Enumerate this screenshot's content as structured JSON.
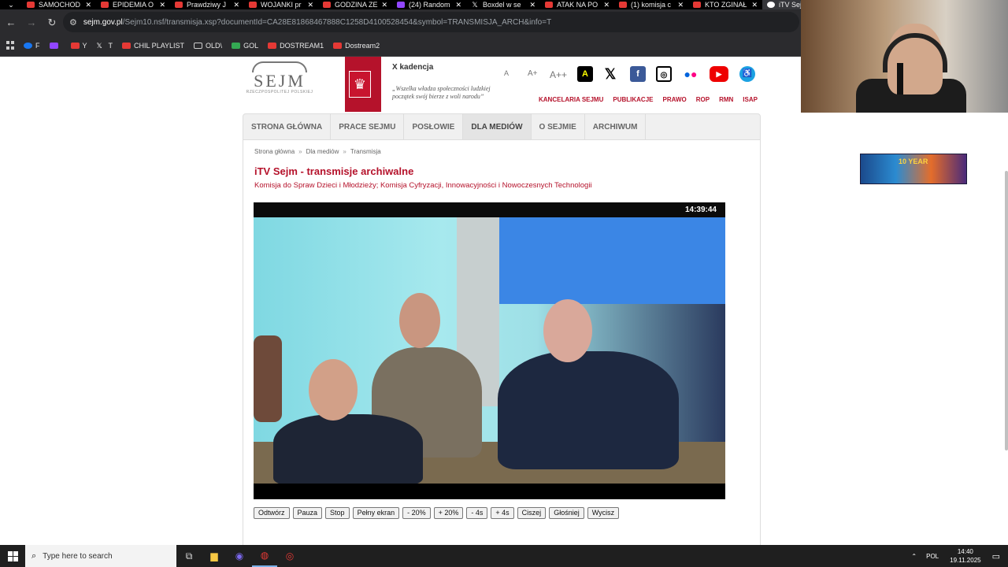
{
  "browser": {
    "tabs": [
      {
        "title": "SAMOCHOD",
        "icon": "youtube-icon"
      },
      {
        "title": "EPIDEMIA O",
        "icon": "youtube-icon"
      },
      {
        "title": "Prawdziwy J",
        "icon": "youtube-icon"
      },
      {
        "title": "WOJANKI pr",
        "icon": "youtube-icon"
      },
      {
        "title": "GODZINA ZE",
        "icon": "youtube-icon"
      },
      {
        "title": "(24) Random",
        "icon": "twitch-icon"
      },
      {
        "title": "Boxdel w se",
        "icon": "x-icon"
      },
      {
        "title": "ATAK NA PO",
        "icon": "youtube-icon"
      },
      {
        "title": "(1) komisja c",
        "icon": "youtube-icon"
      },
      {
        "title": "KTO ZGINAŁ",
        "icon": "youtube-icon"
      },
      {
        "title": "iTV Sejm",
        "icon": "globe-icon"
      }
    ],
    "url_domain": "sejm.gov.pl",
    "url_path": "/Sejm10.nsf/transmisja.xsp?documentId=CA28E81868467888C1258D4100528454&symbol=TRANSMISJA_ARCH&info=T",
    "bookmarks": [
      {
        "label": "F",
        "icon": "facebook-icon"
      },
      {
        "label": "",
        "icon": "twitch-icon"
      },
      {
        "label": "Y",
        "icon": "youtube-icon"
      },
      {
        "label": "T",
        "icon": "x-icon"
      },
      {
        "label": "CHIL PLAYLIST",
        "icon": "youtube-icon"
      },
      {
        "label": "OLD\\",
        "icon": "folder-icon"
      },
      {
        "label": "GOL",
        "icon": "g-icon"
      },
      {
        "label": "DOSTREAM1",
        "icon": "youtube-icon"
      },
      {
        "label": "Dostream2",
        "icon": "youtube-icon"
      }
    ]
  },
  "site": {
    "logo_text": "SEJM",
    "logo_sub": "RZECZPOSPOLITEJ POLSKIEJ",
    "kadencja": "X kadencja",
    "quote": "„Wszelka władza społeczności ludzkiej początek swój bierze z woli narodu”",
    "font_sizes": [
      "A",
      "A+",
      "A++"
    ],
    "contrast": "A",
    "top_links": [
      "KANCELARIA SEJMU",
      "PUBLIKACJE",
      "PRAWO",
      "ROP",
      "RMN",
      "ISAP"
    ],
    "menu": [
      "STRONA GŁÓWNA",
      "PRACE SEJMU",
      "POSŁOWIE",
      "DLA MEDIÓW",
      "O SEJMIE",
      "ARCHIWUM"
    ],
    "menu_active": "DLA MEDIÓW",
    "breadcrumbs": [
      "Strona główna",
      "Dla mediów",
      "Transmisja"
    ],
    "breadcrumb_sep": "»",
    "title": "iTV Sejm - transmisje archiwalne",
    "subtitle": "Komisja do Spraw Dzieci i Młodzieży; Komisja Cyfryzacji, Innowacyjności i Nowoczesnych Technologii",
    "player_clock": "14:39:44",
    "controls": [
      "Odtwórz",
      "Pauza",
      "Stop",
      "Pełny ekran",
      "- 20%",
      "+ 20%",
      "- 4s",
      "+ 4s",
      "Ciszej",
      "Głośniej",
      "Wycisz"
    ]
  },
  "banner_text": "10 YEAR",
  "taskbar": {
    "search_placeholder": "Type here to search",
    "lang": "POL",
    "time": "14:40",
    "date": "19.11.2025"
  },
  "colors": {
    "brand_red": "#b5122b",
    "chrome_dark": "#2b2b2e"
  }
}
